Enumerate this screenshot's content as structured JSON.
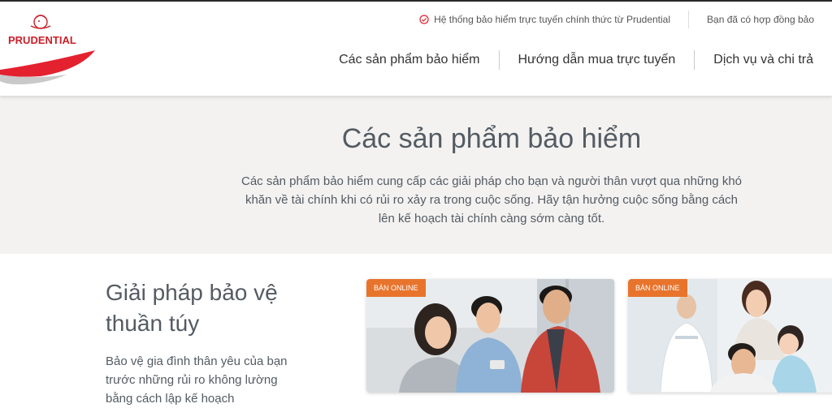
{
  "brand": {
    "name": "PRUDENTIAL",
    "accent": "#e4212f",
    "orange": "#e8742c"
  },
  "utility": {
    "official_text": "Hệ thống bảo hiểm trực tuyến chính thức từ Prudential",
    "contract_text": "Bạn đã có hợp đồng bảo"
  },
  "nav": {
    "items": [
      "Các sản phẩm bảo hiểm",
      "Hướng dẫn mua trực tuyến",
      "Dịch vụ và chi trả"
    ]
  },
  "hero": {
    "title": "Các sản phẩm bảo hiểm",
    "description": "Các sản phẩm bảo hiểm cung cấp các giải pháp cho bạn và người thân vượt qua những khó khăn về tài chính khi có rủi ro xảy ra trong cuộc sống. Hãy tận hưởng cuộc sống bằng cách lên kế hoạch tài chính càng sớm càng tốt."
  },
  "section": {
    "title": "Giải pháp bảo vệ thuần túy",
    "description": "Bảo vệ gia đình thân yêu của bạn trước những rủi ro không lường bằng cách lập kế hoạch"
  },
  "cards": [
    {
      "badge": "BÁN ONLINE",
      "image": "friends-with-phones-photo"
    },
    {
      "badge": "BÁN ONLINE",
      "image": "family-with-doctor-photo"
    }
  ]
}
